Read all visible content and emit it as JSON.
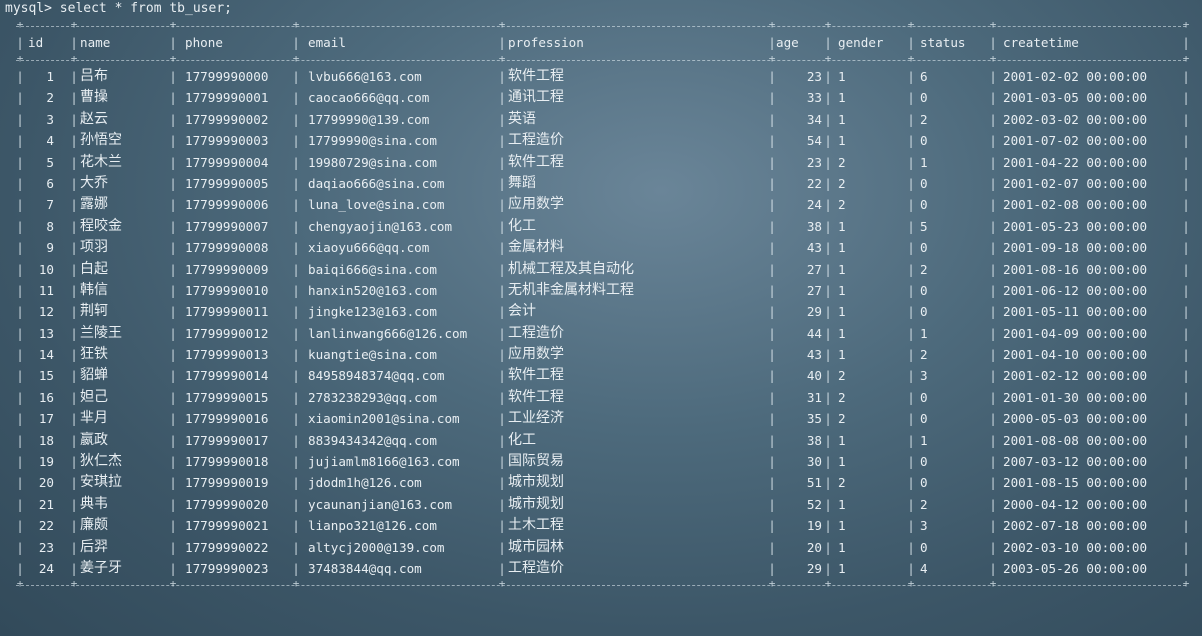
{
  "terminal": {
    "prompt": "mysql> select * from tb_user;"
  },
  "table": {
    "columns": [
      "id",
      "name",
      "phone",
      "email",
      "profession",
      "age",
      "gender",
      "status",
      "createtime"
    ],
    "rows": [
      [
        "1",
        "吕布",
        "17799990000",
        "lvbu666@163.com",
        "软件工程",
        "23",
        "1",
        "6",
        "2001-02-02 00:00:00"
      ],
      [
        "2",
        "曹操",
        "17799990001",
        "caocao666@qq.com",
        "通讯工程",
        "33",
        "1",
        "0",
        "2001-03-05 00:00:00"
      ],
      [
        "3",
        "赵云",
        "17799990002",
        "17799990@139.com",
        "英语",
        "34",
        "1",
        "2",
        "2002-03-02 00:00:00"
      ],
      [
        "4",
        "孙悟空",
        "17799990003",
        "17799990@sina.com",
        "工程造价",
        "54",
        "1",
        "0",
        "2001-07-02 00:00:00"
      ],
      [
        "5",
        "花木兰",
        "17799990004",
        "19980729@sina.com",
        "软件工程",
        "23",
        "2",
        "1",
        "2001-04-22 00:00:00"
      ],
      [
        "6",
        "大乔",
        "17799990005",
        "daqiao666@sina.com",
        "舞蹈",
        "22",
        "2",
        "0",
        "2001-02-07 00:00:00"
      ],
      [
        "7",
        "露娜",
        "17799990006",
        "luna_love@sina.com",
        "应用数学",
        "24",
        "2",
        "0",
        "2001-02-08 00:00:00"
      ],
      [
        "8",
        "程咬金",
        "17799990007",
        "chengyaojin@163.com",
        "化工",
        "38",
        "1",
        "5",
        "2001-05-23 00:00:00"
      ],
      [
        "9",
        "项羽",
        "17799990008",
        "xiaoyu666@qq.com",
        "金属材料",
        "43",
        "1",
        "0",
        "2001-09-18 00:00:00"
      ],
      [
        "10",
        "白起",
        "17799990009",
        "baiqi666@sina.com",
        "机械工程及其自动化",
        "27",
        "1",
        "2",
        "2001-08-16 00:00:00"
      ],
      [
        "11",
        "韩信",
        "17799990010",
        "hanxin520@163.com",
        "无机非金属材料工程",
        "27",
        "1",
        "0",
        "2001-06-12 00:00:00"
      ],
      [
        "12",
        "荆轲",
        "17799990011",
        "jingke123@163.com",
        "会计",
        "29",
        "1",
        "0",
        "2001-05-11 00:00:00"
      ],
      [
        "13",
        "兰陵王",
        "17799990012",
        "lanlinwang666@126.com",
        "工程造价",
        "44",
        "1",
        "1",
        "2001-04-09 00:00:00"
      ],
      [
        "14",
        "狂铁",
        "17799990013",
        "kuangtie@sina.com",
        "应用数学",
        "43",
        "1",
        "2",
        "2001-04-10 00:00:00"
      ],
      [
        "15",
        "貂蝉",
        "17799990014",
        "84958948374@qq.com",
        "软件工程",
        "40",
        "2",
        "3",
        "2001-02-12 00:00:00"
      ],
      [
        "16",
        "妲己",
        "17799990015",
        "2783238293@qq.com",
        "软件工程",
        "31",
        "2",
        "0",
        "2001-01-30 00:00:00"
      ],
      [
        "17",
        "芈月",
        "17799990016",
        "xiaomin2001@sina.com",
        "工业经济",
        "35",
        "2",
        "0",
        "2000-05-03 00:00:00"
      ],
      [
        "18",
        "嬴政",
        "17799990017",
        "8839434342@qq.com",
        "化工",
        "38",
        "1",
        "1",
        "2001-08-08 00:00:00"
      ],
      [
        "19",
        "狄仁杰",
        "17799990018",
        "jujiamlm8166@163.com",
        "国际贸易",
        "30",
        "1",
        "0",
        "2007-03-12 00:00:00"
      ],
      [
        "20",
        "安琪拉",
        "17799990019",
        "jdodm1h@126.com",
        "城市规划",
        "51",
        "2",
        "0",
        "2001-08-15 00:00:00"
      ],
      [
        "21",
        "典韦",
        "17799990020",
        "ycaunanjian@163.com",
        "城市规划",
        "52",
        "1",
        "2",
        "2000-04-12 00:00:00"
      ],
      [
        "22",
        "廉颇",
        "17799990021",
        "lianpo321@126.com",
        "土木工程",
        "19",
        "1",
        "3",
        "2002-07-18 00:00:00"
      ],
      [
        "23",
        "后羿",
        "17799990022",
        "altycj2000@139.com",
        "城市园林",
        "20",
        "1",
        "0",
        "2002-03-10 00:00:00"
      ],
      [
        "24",
        "姜子牙",
        "17799990023",
        "37483844@qq.com",
        "工程造价",
        "29",
        "1",
        "4",
        "2003-05-26 00:00:00"
      ]
    ]
  }
}
